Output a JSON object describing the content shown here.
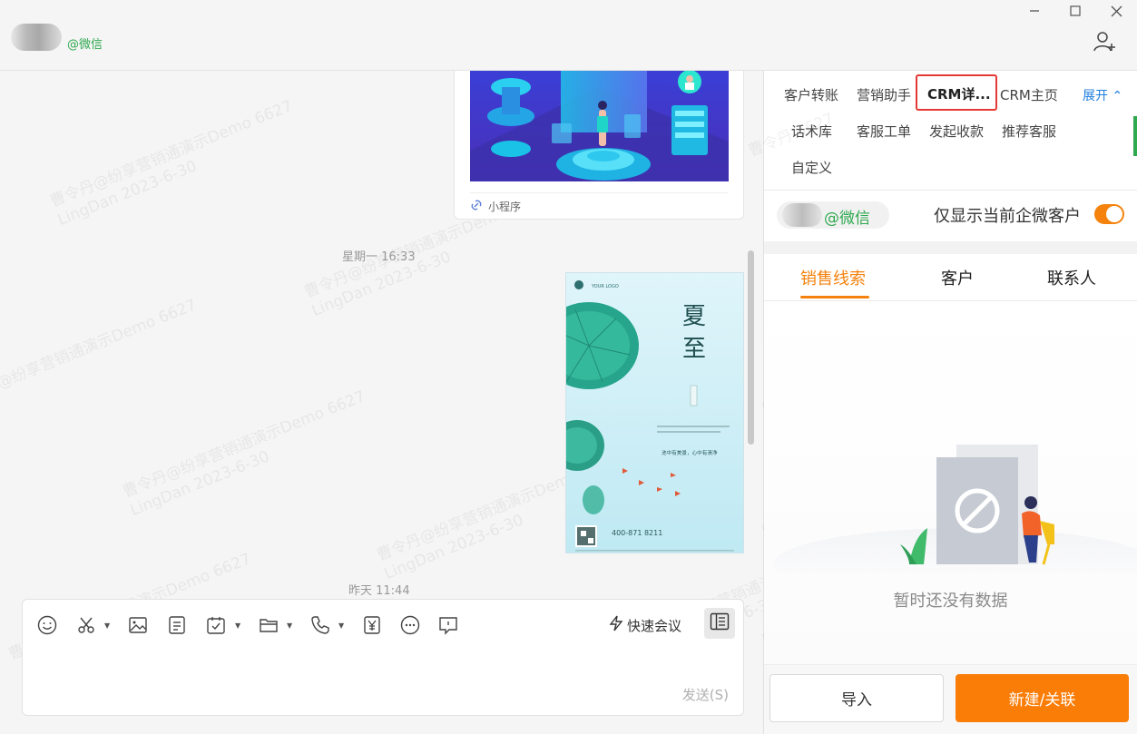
{
  "header": {
    "contact_tag": "@微信",
    "window_controls": [
      "minimize-icon",
      "maximize-icon",
      "close-icon"
    ]
  },
  "chat": {
    "mini_program_label": "小程序",
    "timestamp_1": "星期一 16:33",
    "timestamp_2": "昨天 11:44",
    "poster_title_1": "夏",
    "poster_title_2": "至",
    "poster_logo": "YOUR LOGO",
    "poster_slogan": "池中有美景，心中有清净",
    "poster_phone": "400-871 8211",
    "watermark_line1": "曹令丹@纷享营销通演示Demo 6627",
    "watermark_line2": "LingDan 2023-6-30"
  },
  "input": {
    "tools": [
      "emoji-icon",
      "scissors-icon",
      "image-icon",
      "document-icon",
      "calendar-check-icon",
      "folder-icon",
      "phone-icon",
      "yuan-icon",
      "more-icon",
      "chat-bubble-icon"
    ],
    "quick_meeting": "快速会议",
    "send": "发送(S)"
  },
  "panel": {
    "tools_row1": [
      "客户转账",
      "营销助手",
      "CRM详...",
      "CRM主页"
    ],
    "expand": "展开",
    "tools_row2": [
      "话术库",
      "客服工单",
      "发起收款",
      "推荐客服"
    ],
    "tools_row3": [
      "自定义"
    ],
    "contact_tag": "@微信",
    "only_current": "仅显示当前企微客户",
    "toggle_on": true,
    "tabs": [
      "销售线索",
      "客户",
      "联系人"
    ],
    "active_tab": 0,
    "empty_text": "暂时还没有数据",
    "import_button": "导入",
    "new_button": "新建/关联",
    "watermark": "曹令丹 6627",
    "accent_color": "#f5820d"
  }
}
